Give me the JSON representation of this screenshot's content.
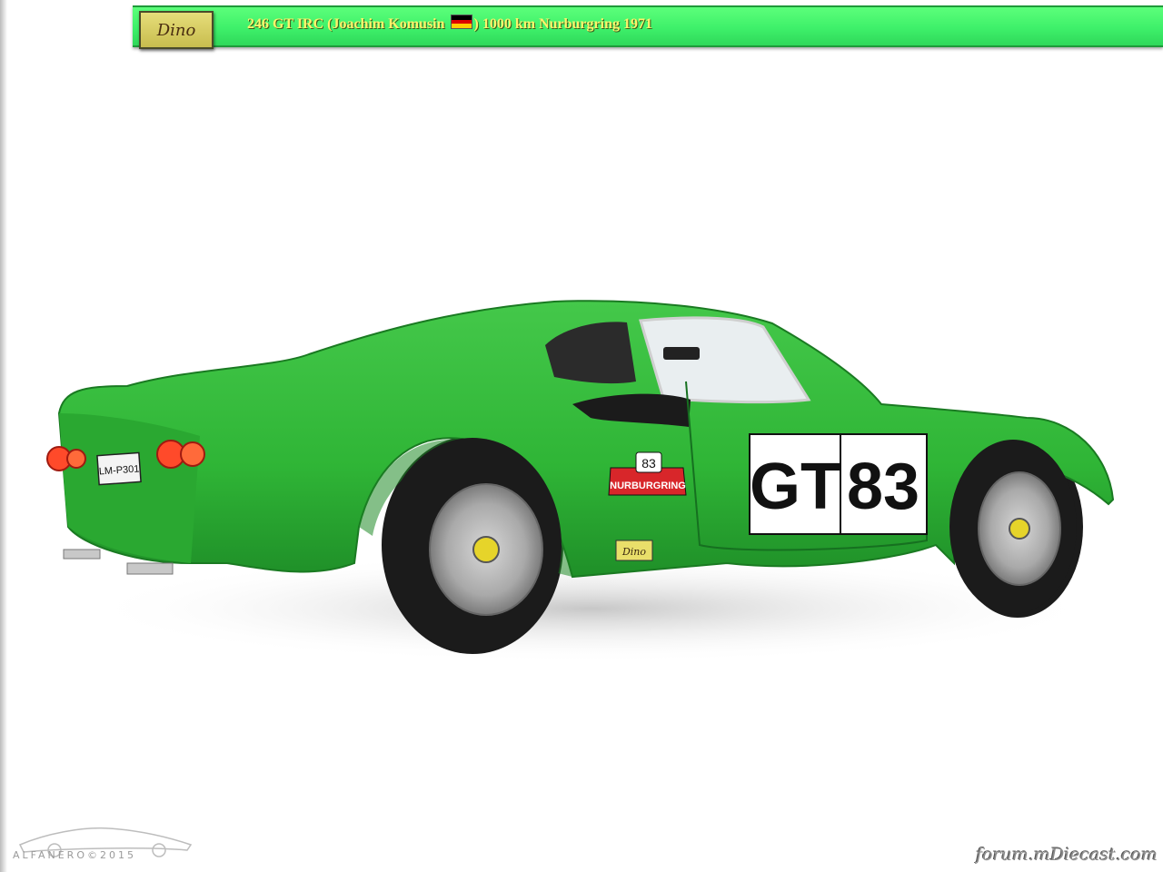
{
  "header": {
    "logo_text": "Dino",
    "title_before_flag": "246 GT  IRC (Joachim Komusin ",
    "title_after_flag": ") 1000 km Nurburgring 1971",
    "flag_colors": [
      "#000000",
      "#dd0000",
      "#ffce00"
    ]
  },
  "car": {
    "body_color": "#2fb536",
    "plate": "LM-P301",
    "door_number_prefix": "GT",
    "door_number": "83",
    "rally_plate_number": "83",
    "rally_plate_text": "NURBURGRING",
    "side_badge": "Dino"
  },
  "watermarks": {
    "left": "ALFANERO©2015",
    "right": "forum.mDiecast.com"
  }
}
